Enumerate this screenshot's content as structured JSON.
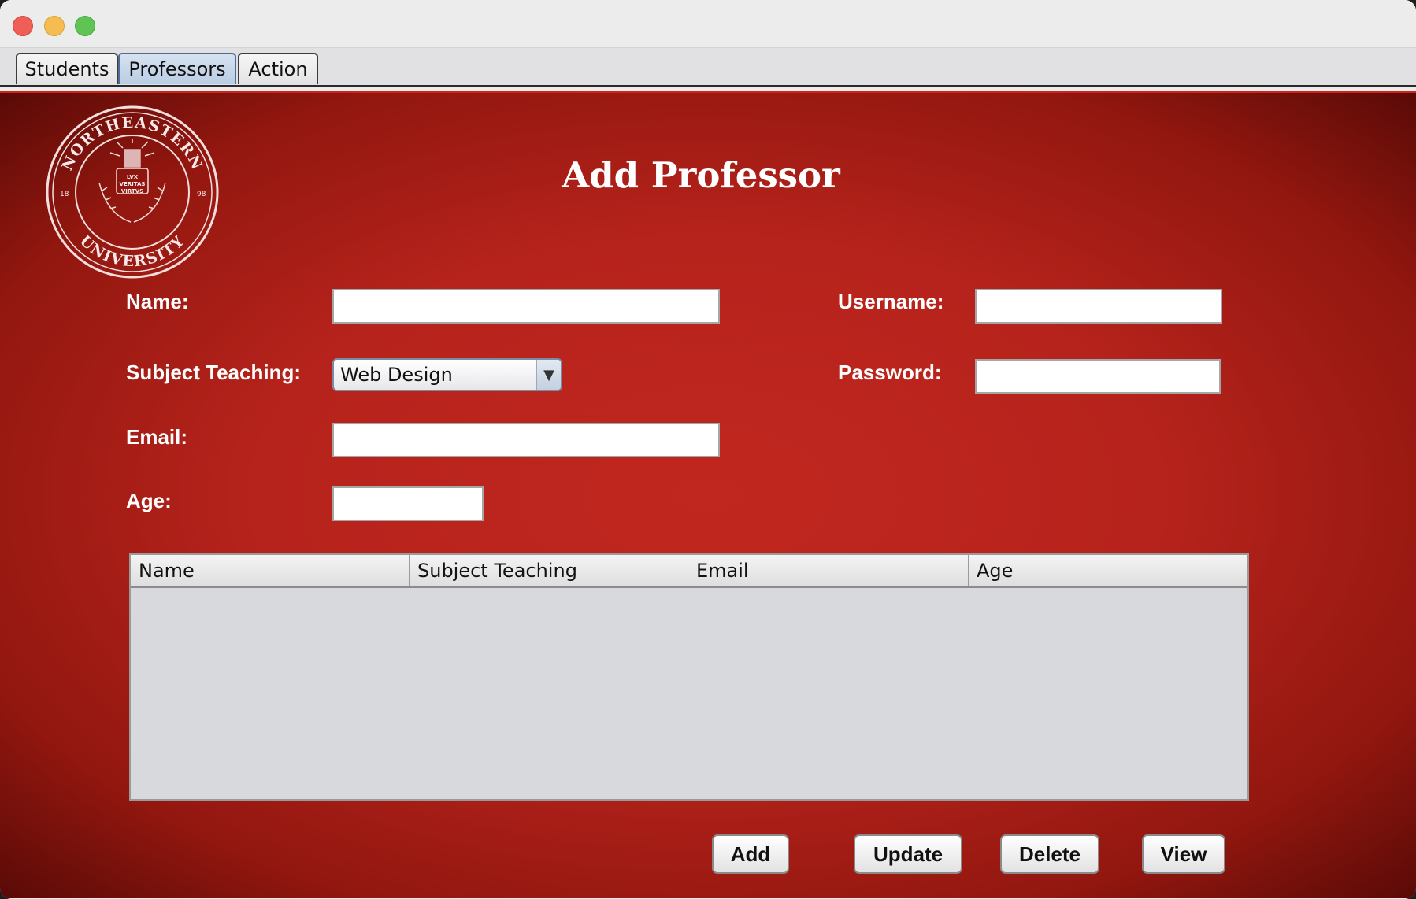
{
  "tabs": [
    {
      "label": "Students"
    },
    {
      "label": "Professors",
      "selected": true
    },
    {
      "label": "Action"
    }
  ],
  "seal": {
    "top_text": "NORTHEASTERN",
    "bottom_text": "UNIVERSITY",
    "left_year": "18",
    "right_year": "98",
    "motto": [
      "LVX",
      "VERITAS",
      "VIRTVS"
    ]
  },
  "form": {
    "title": "Add Professor",
    "name_label": "Name:",
    "name_value": "",
    "subject_label": "Subject Teaching:",
    "subject_value": "Web Design",
    "email_label": "Email:",
    "email_value": "",
    "age_label": "Age:",
    "age_value": "",
    "username_label": "Username:",
    "username_value": "",
    "password_label": "Password:",
    "password_value": ""
  },
  "table": {
    "columns": [
      "Name",
      "Subject Teaching",
      "Email",
      "Age"
    ],
    "rows": []
  },
  "buttons": {
    "add": "Add",
    "update": "Update",
    "delete": "Delete",
    "view": "View"
  },
  "colors": {
    "panel_red": "#b6231c",
    "panel_dark": "#5a0a07",
    "selected_tab": "#b9cde3"
  }
}
